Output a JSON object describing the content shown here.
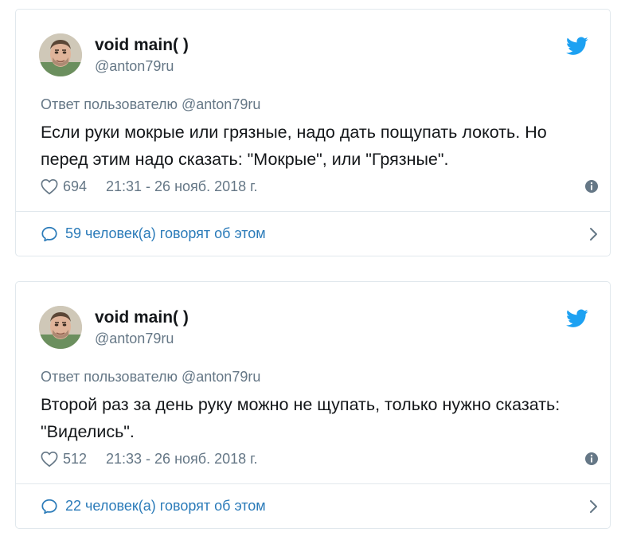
{
  "tweets": [
    {
      "display_name": "void main( )",
      "handle": "@anton79ru",
      "reply_to": "Ответ пользователю @anton79ru",
      "text": "Если руки мокрые или грязные, надо дать пощупать локоть. Но перед этим надо сказать: \"Мокрые\", или \"Грязные\".",
      "likes": "694",
      "timestamp": "21:31 - 26 нояб. 2018 г.",
      "conversation": "59 человек(а) говорят об этом"
    },
    {
      "display_name": "void main( )",
      "handle": "@anton79ru",
      "reply_to": "Ответ пользователю @anton79ru",
      "text": "Второй раз за день руку можно не щупать, только нужно сказать: \"Виделись\".",
      "likes": "512",
      "timestamp": "21:33 - 26 нояб. 2018 г.",
      "conversation": "22 человек(а) говорят об этом"
    }
  ],
  "icons": {
    "brand": "twitter-bird-icon",
    "like": "heart-icon",
    "info": "info-icon",
    "conversation": "speech-bubble-icon",
    "open": "chevron-right-icon"
  },
  "colors": {
    "twitter_blue": "#1da1f2",
    "link_blue": "#2b7bb9",
    "secondary_text": "#657786",
    "border": "#e1e8ed"
  }
}
